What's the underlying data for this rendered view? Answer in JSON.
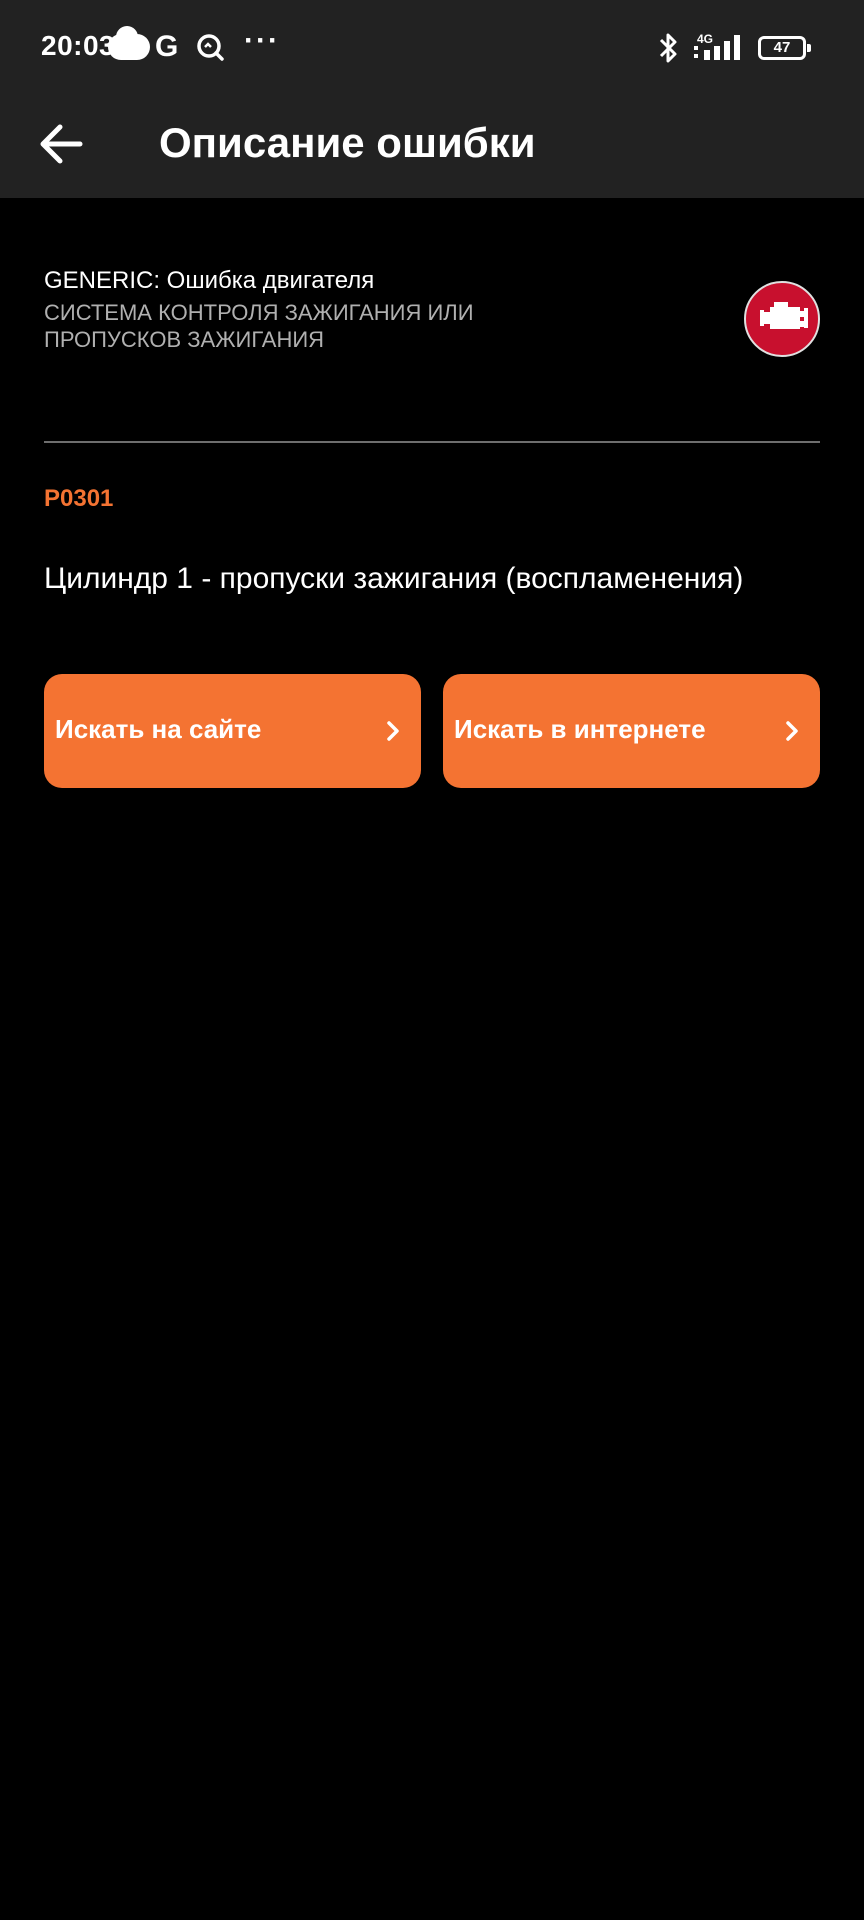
{
  "status_bar": {
    "time": "20:03",
    "google_glyph": "G",
    "more_glyph": "···",
    "network": "4G",
    "battery_level": "47",
    "icons": [
      "cloud-icon",
      "google-icon",
      "search-status-icon",
      "more-icon",
      "bluetooth-icon",
      "signal-icon",
      "battery-icon"
    ]
  },
  "app_bar": {
    "title": "Описание ошибки",
    "back_icon": "arrow-left-icon"
  },
  "error": {
    "category": "GENERIC: Ошибка двигателя",
    "system": "СИСТЕМА КОНТРОЛЯ ЗАЖИГАНИЯ ИЛИ ПРОПУСКОВ ЗАЖИГАНИЯ",
    "code": "P0301",
    "description": "Цилиндр 1 - пропуски зажигания (воспламенения)",
    "badge_icon": "check-engine-icon",
    "badge_color": "#c8102e"
  },
  "buttons": {
    "search_site": "Искать на сайте",
    "search_web": "Искать в интернете",
    "chevron_icon": "chevron-right-icon"
  },
  "colors": {
    "accent": "#f47332",
    "background": "#000000",
    "bar": "#222222"
  }
}
